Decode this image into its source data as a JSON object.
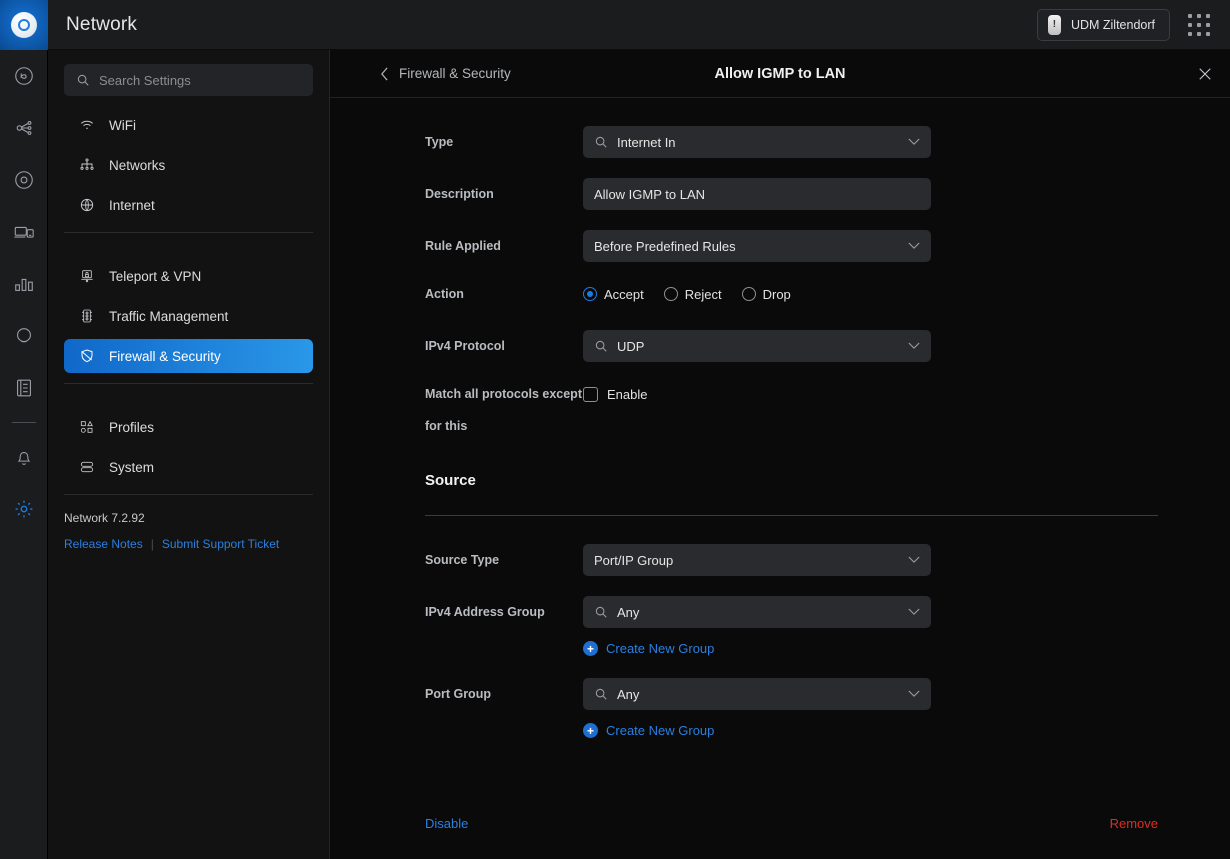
{
  "app": {
    "title": "Network",
    "device_chip": "UDM Ziltendorf",
    "apps_icon": "apps-grid-icon",
    "logo_icon": "unifi-logo-icon"
  },
  "rail": {
    "items": [
      {
        "name": "dashboard-icon",
        "active": false
      },
      {
        "name": "topology-icon",
        "active": false
      },
      {
        "name": "devices-icon",
        "active": false
      },
      {
        "name": "clients-icon",
        "active": false
      },
      {
        "name": "statistics-icon",
        "active": false
      },
      {
        "name": "hotspot-icon",
        "active": false
      },
      {
        "name": "logs-icon",
        "active": false
      },
      {
        "name": "alerts-bell-icon",
        "active": false
      },
      {
        "name": "settings-gear-icon",
        "active": true
      }
    ]
  },
  "sidebar": {
    "search": {
      "placeholder": "Search Settings",
      "value": "",
      "icon": "search-icon"
    },
    "group_one": [
      {
        "label": "WiFi",
        "icon": "wifi-icon",
        "active": false
      },
      {
        "label": "Networks",
        "icon": "networks-icon",
        "active": false
      },
      {
        "label": "Internet",
        "icon": "globe-icon",
        "active": false
      }
    ],
    "group_two": [
      {
        "label": "Teleport & VPN",
        "icon": "vpn-lock-icon",
        "active": false
      },
      {
        "label": "Traffic Management",
        "icon": "traffic-light-icon",
        "active": false
      },
      {
        "label": "Firewall & Security",
        "icon": "shield-icon",
        "active": true
      }
    ],
    "group_three": [
      {
        "label": "Profiles",
        "icon": "profiles-shapes-icon",
        "active": false
      },
      {
        "label": "System",
        "icon": "system-server-icon",
        "active": false
      }
    ],
    "version": "Network 7.2.92",
    "links": {
      "release_notes": "Release Notes",
      "separator": "|",
      "support_ticket": "Submit Support Ticket"
    }
  },
  "panel": {
    "back_label": "Firewall & Security",
    "back_icon": "chevron-left-icon",
    "title": "Allow IGMP to LAN",
    "close_icon": "close-icon",
    "fields": {
      "type": {
        "label": "Type",
        "value": "Internet In",
        "icon": "search-icon",
        "chevron": "chevron-down-icon"
      },
      "description": {
        "label": "Description",
        "value": "Allow IGMP to LAN"
      },
      "rule_applied": {
        "label": "Rule Applied",
        "value": "Before Predefined Rules",
        "chevron": "chevron-down-icon"
      },
      "action": {
        "label": "Action",
        "options": [
          {
            "label": "Accept",
            "selected": true
          },
          {
            "label": "Reject",
            "selected": false
          },
          {
            "label": "Drop",
            "selected": false
          }
        ]
      },
      "ipv4_protocol": {
        "label": "IPv4 Protocol",
        "value": "UDP",
        "icon": "search-icon",
        "chevron": "chevron-down-icon"
      },
      "match_except": {
        "label": "Match all protocols except for this",
        "checkbox_label": "Enable",
        "checked": false
      }
    },
    "source": {
      "heading": "Source",
      "source_type": {
        "label": "Source Type",
        "value": "Port/IP Group",
        "chevron": "chevron-down-icon"
      },
      "ipv4_address_group": {
        "label": "IPv4 Address Group",
        "value": "Any",
        "icon": "search-icon",
        "chevron": "chevron-down-icon"
      },
      "ipv4_create_link": "Create New Group",
      "port_group": {
        "label": "Port Group",
        "value": "Any",
        "icon": "search-icon",
        "chevron": "chevron-down-icon"
      },
      "port_create_link": "Create New Group",
      "plus_icon": "plus-circle-icon"
    },
    "footer": {
      "disable_label": "Disable",
      "remove_label": "Remove"
    }
  },
  "colors": {
    "accent_blue": "#2b7fe0",
    "active_nav_gradient_start": "#1068c9",
    "active_nav_gradient_end": "#2a97e8",
    "danger_red": "#d93025",
    "panel_bg": "#0a0a0a",
    "sidebar_bg": "#121212",
    "field_bg": "#2a2b2e"
  }
}
